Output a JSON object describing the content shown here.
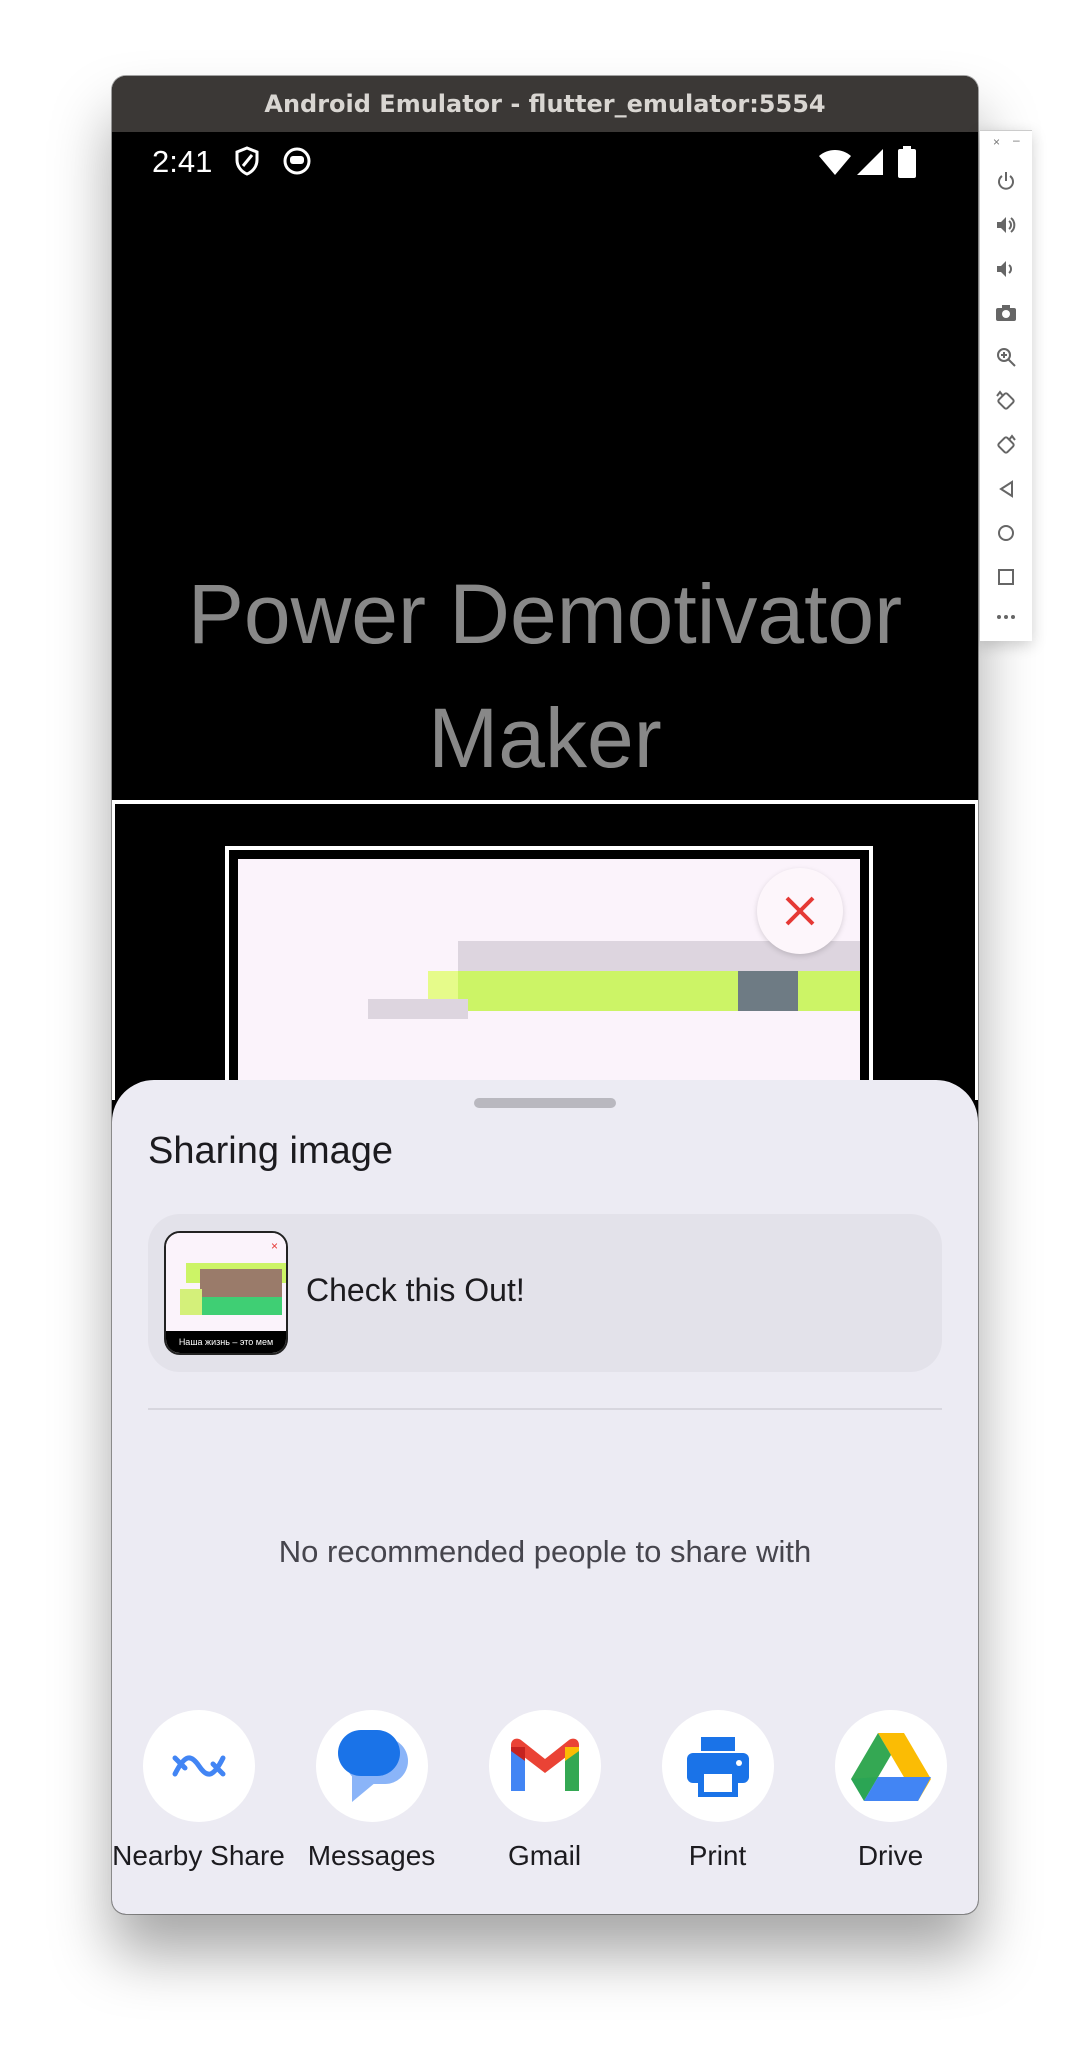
{
  "window": {
    "title": "Android Emulator - flutter_emulator:5554"
  },
  "status_bar": {
    "time": "2:41"
  },
  "app": {
    "title": "Power Demotivator Maker"
  },
  "share_sheet": {
    "title": "Sharing image",
    "share_text": "Check this Out!",
    "thumbnail_caption": "Наша жизнь – это мем",
    "empty_message": "No recommended people to share with",
    "targets": [
      {
        "label": "Nearby Share",
        "icon": "nearby-share-icon"
      },
      {
        "label": "Messages",
        "icon": "messages-icon"
      },
      {
        "label": "Gmail",
        "icon": "gmail-icon"
      },
      {
        "label": "Print",
        "icon": "print-icon"
      },
      {
        "label": "Drive",
        "icon": "drive-icon"
      }
    ]
  },
  "emulator_toolbar": {
    "buttons": [
      "power",
      "volume-up",
      "volume-down",
      "screenshot",
      "zoom",
      "rotate-left",
      "rotate-right",
      "back",
      "home",
      "overview",
      "more"
    ]
  },
  "colors": {
    "titlebar": "#3b3836",
    "sheet_bg": "#ecebf3",
    "accent_red": "#e53935",
    "lime": "#ccf466",
    "slate": "#6e7b84"
  }
}
